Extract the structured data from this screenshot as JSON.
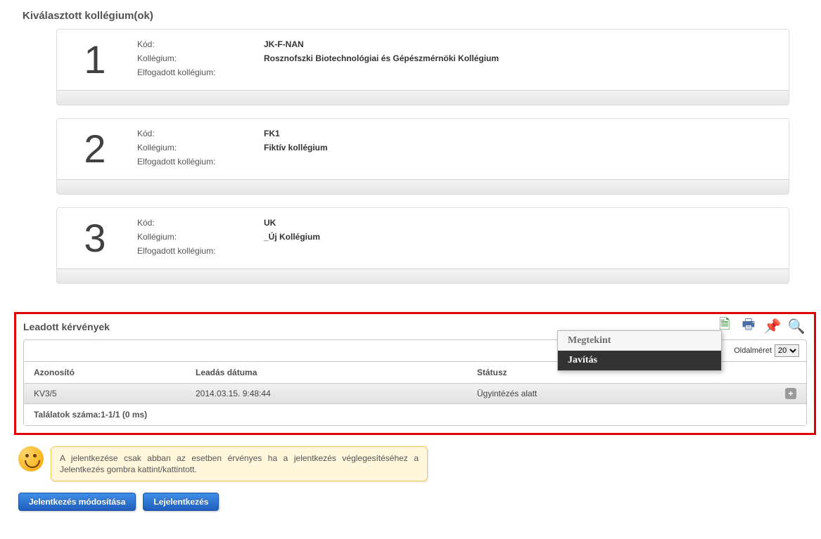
{
  "section_title": "Kiválasztott kollégium(ok)",
  "labels": {
    "code": "Kód:",
    "dorm": "Kollégium:",
    "accepted": "Elfogadott kollégium:"
  },
  "choices": [
    {
      "rank": "1",
      "code": "JK-F-NAN",
      "dorm": "Rosznofszki Biotechnológiai és Gépészmérnöki Kollégium",
      "accepted": ""
    },
    {
      "rank": "2",
      "code": "FK1",
      "dorm": "Fiktív kollégium",
      "accepted": ""
    },
    {
      "rank": "3",
      "code": "UK",
      "dorm": "_Új Kollégium",
      "accepted": ""
    }
  ],
  "submitted": {
    "title": "Leadott kérvények",
    "page_size_label": "Oldalméret",
    "page_size_value": "20",
    "columns": {
      "id": "Azonosító",
      "date": "Leadás dátuma",
      "status": "Státusz"
    },
    "rows": [
      {
        "id": "KV3/5",
        "date": "2014.03.15. 9:48:44",
        "status": "Ügyintézés alatt"
      }
    ],
    "footer": "Találatok száma:1-1/1 (0 ms)"
  },
  "context_menu": {
    "view": "Megtekint",
    "fix": "Javítás"
  },
  "notice": "A jelentkezése csak abban az esetben érvényes ha a jelentkezés véglegesítéséhez a Jelentkezés gombra kattint/kattintott.",
  "buttons": {
    "modify": "Jelentkezés módosítása",
    "signoff": "Lejelentkezés"
  }
}
